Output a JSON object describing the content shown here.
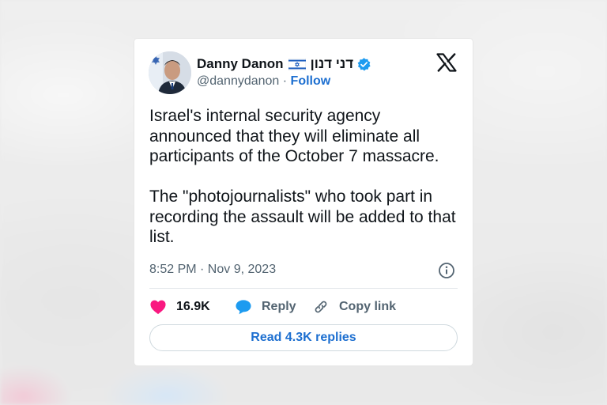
{
  "author": {
    "name": "Danny Danon",
    "hebrew_name": "דני דנון",
    "handle": "@dannydanon",
    "separator": " · ",
    "follow_label": "Follow",
    "avatar_icon": "profile-photo",
    "flag_icon": "israel-flag-icon",
    "verified_icon": "verified-badge-icon"
  },
  "platform": {
    "logo_icon": "x-logo-icon"
  },
  "tweet": {
    "text": "Israel's internal security agency announced that they will eliminate all participants of the October 7 massacre.\n\nThe \"photojournalists\" who took part in recording the assault will be added to that list.",
    "timestamp": "8:52 PM · Nov 9, 2023",
    "info_icon": "info-icon"
  },
  "actions": {
    "like_count": "16.9K",
    "like_icon": "heart-icon",
    "reply_label": "Reply",
    "reply_icon": "speech-bubble-icon",
    "copy_label": "Copy link",
    "copy_icon": "link-icon"
  },
  "replies_button": {
    "label": "Read 4.3K replies"
  },
  "colors": {
    "accent": "#1d9bf0",
    "link": "#1d6fd0",
    "heart": "#f91880",
    "text": "#0f1419",
    "muted": "#536471"
  }
}
